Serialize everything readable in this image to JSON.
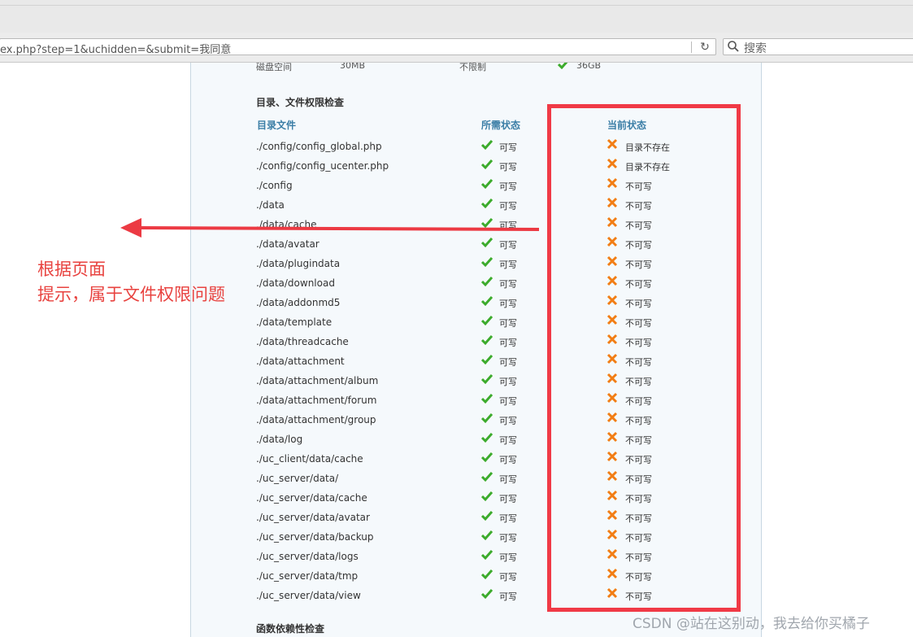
{
  "browser": {
    "url": "ex.php?step=1&uchidden=&submit=我同意",
    "search_placeholder": "搜索",
    "reload_glyph": "↻"
  },
  "disk": {
    "label": "磁盘空间",
    "required": "30MB",
    "best": "不限制",
    "current": "36GB"
  },
  "section": {
    "title": "目录、文件权限检查",
    "headers": {
      "file": "目录文件",
      "required": "所需状态",
      "current": "当前状态"
    },
    "rows": [
      {
        "path": "./config/config_global.php",
        "required": "可写",
        "current": "目录不存在"
      },
      {
        "path": "./config/config_ucenter.php",
        "required": "可写",
        "current": "目录不存在"
      },
      {
        "path": "./config",
        "required": "可写",
        "current": "不可写"
      },
      {
        "path": "./data",
        "required": "可写",
        "current": "不可写"
      },
      {
        "path": "./data/cache",
        "required": "可写",
        "current": "不可写"
      },
      {
        "path": "./data/avatar",
        "required": "可写",
        "current": "不可写"
      },
      {
        "path": "./data/plugindata",
        "required": "可写",
        "current": "不可写"
      },
      {
        "path": "./data/download",
        "required": "可写",
        "current": "不可写"
      },
      {
        "path": "./data/addonmd5",
        "required": "可写",
        "current": "不可写"
      },
      {
        "path": "./data/template",
        "required": "可写",
        "current": "不可写"
      },
      {
        "path": "./data/threadcache",
        "required": "可写",
        "current": "不可写"
      },
      {
        "path": "./data/attachment",
        "required": "可写",
        "current": "不可写"
      },
      {
        "path": "./data/attachment/album",
        "required": "可写",
        "current": "不可写"
      },
      {
        "path": "./data/attachment/forum",
        "required": "可写",
        "current": "不可写"
      },
      {
        "path": "./data/attachment/group",
        "required": "可写",
        "current": "不可写"
      },
      {
        "path": "./data/log",
        "required": "可写",
        "current": "不可写"
      },
      {
        "path": "./uc_client/data/cache",
        "required": "可写",
        "current": "不可写"
      },
      {
        "path": "./uc_server/data/",
        "required": "可写",
        "current": "不可写"
      },
      {
        "path": "./uc_server/data/cache",
        "required": "可写",
        "current": "不可写"
      },
      {
        "path": "./uc_server/data/avatar",
        "required": "可写",
        "current": "不可写"
      },
      {
        "path": "./uc_server/data/backup",
        "required": "可写",
        "current": "不可写"
      },
      {
        "path": "./uc_server/data/logs",
        "required": "可写",
        "current": "不可写"
      },
      {
        "path": "./uc_server/data/tmp",
        "required": "可写",
        "current": "不可写"
      },
      {
        "path": "./uc_server/data/view",
        "required": "可写",
        "current": "不可写"
      }
    ]
  },
  "next_section": {
    "title": "函数依赖性检查"
  },
  "annotation": {
    "line1": "根据页面",
    "line2": "提示，属于文件权限问题"
  },
  "watermark": "CSDN @站在这别动，我去给你买橘子",
  "colors": {
    "ok": "#3cab2c",
    "fail": "#f27d14",
    "header": "#3b7ea6",
    "annotation": "#e8423f"
  },
  "icons": {
    "ok": "check-icon",
    "fail": "cross-icon"
  }
}
